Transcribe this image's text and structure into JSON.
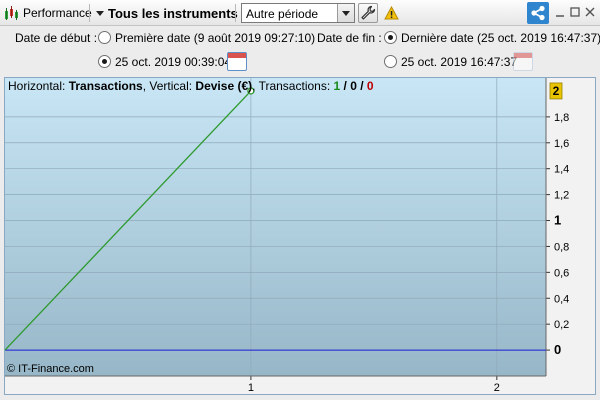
{
  "toolbar": {
    "performance_label": "Performance",
    "instruments_label": "Tous les instruments",
    "period_value": "Autre période"
  },
  "options": {
    "start_label": "Date de début :",
    "start_first_label": "Première date (9 août 2019 09:27:10)",
    "start_custom_label": "25 oct. 2019 00:39:04",
    "end_label": "Date de fin :",
    "end_last_label": "Dernière date (25 oct. 2019 16:47:37)",
    "end_custom_label": "25 oct. 2019 16:47:37"
  },
  "chart_header": {
    "horizontal_prefix": "Horizontal: ",
    "horizontal_value": "Transactions",
    "vertical_prefix": ", Vertical: ",
    "vertical_value": "Devise (€)",
    "transactions_prefix": ", Transactions: ",
    "tx_win": "1",
    "tx_sep1": " / ",
    "tx_neutral": "0",
    "tx_sep2": " / ",
    "tx_loss": "0"
  },
  "copyright": "© IT-Finance.com",
  "colors": {
    "series_line": "#2e9a2e",
    "baseline": "#1b1bd6",
    "win": "#1a8a1a",
    "loss": "#c00000",
    "last_value_marker": "#e8c400"
  },
  "chart_data": {
    "type": "line",
    "xlabel": "Transactions",
    "ylabel": "Devise (€)",
    "x": [
      0,
      1
    ],
    "y": [
      0,
      2
    ],
    "xlim": [
      0,
      2.2
    ],
    "ylim": [
      -0.2,
      2.1
    ],
    "x_ticks": [
      1,
      2
    ],
    "x_tick_labels": [
      "1",
      "2"
    ],
    "y_ticks": [
      0,
      0.2,
      0.4,
      0.6,
      0.8,
      1,
      1.2,
      1.4,
      1.6,
      1.8
    ],
    "y_tick_labels": [
      "0",
      "0,2",
      "0,4",
      "0,6",
      "0,8",
      "1",
      "1,2",
      "1,4",
      "1,6",
      "1,8"
    ],
    "y_bold_ticks": [
      0,
      1
    ],
    "last_value": 2,
    "last_value_label": "2",
    "grid": true
  }
}
